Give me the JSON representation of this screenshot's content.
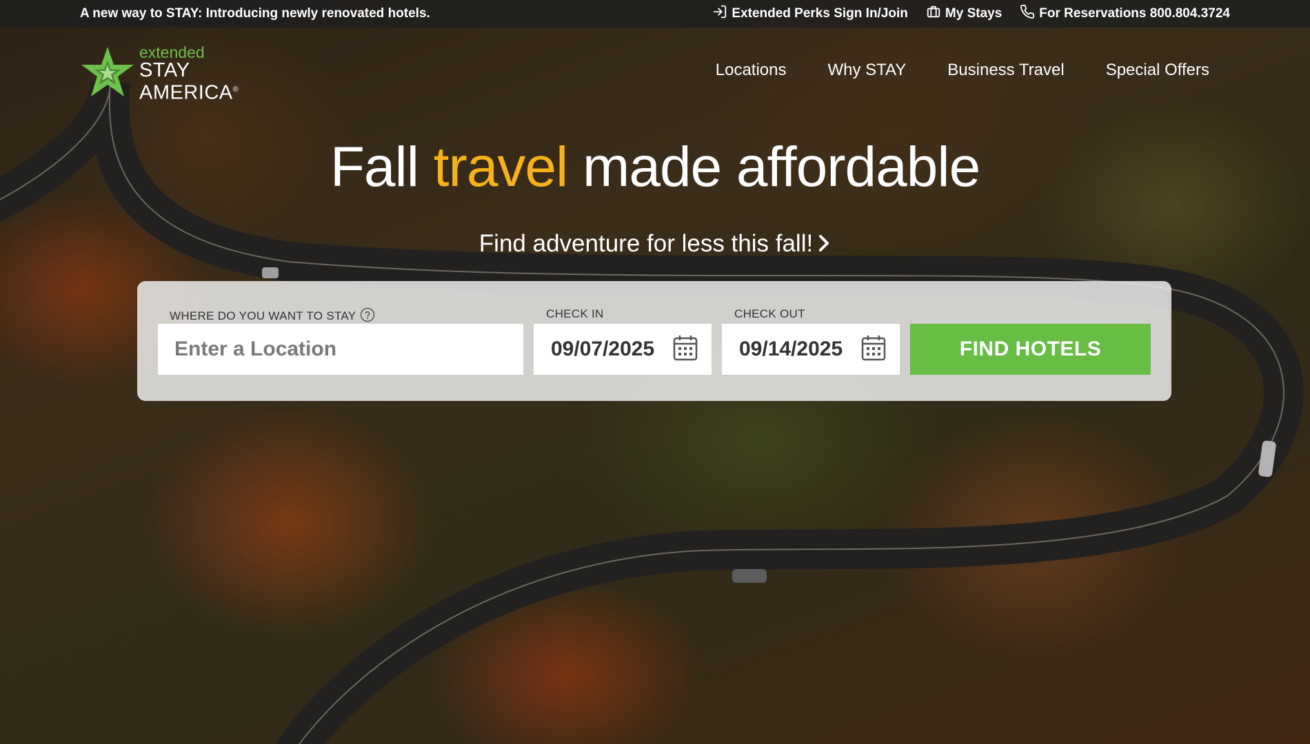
{
  "utility_bar": {
    "announcement": "A new way to STAY: Introducing newly renovated hotels.",
    "sign_in": "Extended Perks Sign In/Join",
    "my_stays": "My Stays",
    "reservations": "For Reservations 800.804.3724"
  },
  "brand": {
    "line1": "extended",
    "line2": "STAY",
    "line3": "AMERICA",
    "registered": "®",
    "green": "#6dc04b"
  },
  "nav": {
    "items": [
      {
        "label": "Locations"
      },
      {
        "label": "Why STAY"
      },
      {
        "label": "Business Travel"
      },
      {
        "label": "Special Offers"
      }
    ]
  },
  "hero": {
    "headline_part1": "Fall ",
    "headline_accent": "travel",
    "headline_part2": " made affordable",
    "accent_color": "#f5b21a",
    "subhead": "Find adventure for less this fall!"
  },
  "booking": {
    "location_label": "WHERE DO YOU WANT TO STAY",
    "location_placeholder": "Enter a Location",
    "checkin_label": "CHECK IN",
    "checkin_value": "09/07/2025",
    "checkout_label": "CHECK OUT",
    "checkout_value": "09/14/2025",
    "submit_label": "FIND HOTELS",
    "button_color": "#68bd45"
  },
  "icons": {
    "sign_in": "sign-in-icon",
    "my_stays": "suitcase-icon",
    "reservations": "phone-icon",
    "help": "question-circle-icon",
    "calendar": "calendar-icon",
    "subhead": "chevron-right-icon",
    "logo": "star-logo-icon"
  }
}
